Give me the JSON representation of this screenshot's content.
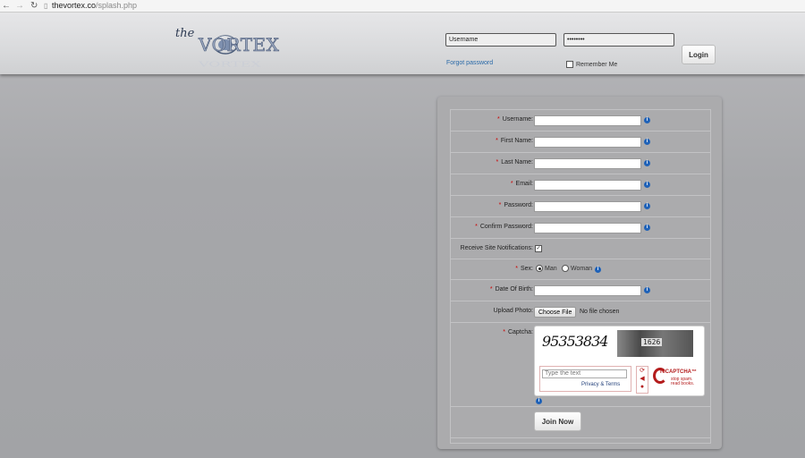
{
  "browser": {
    "back_icon": "back-arrow",
    "forward_icon": "forward-arrow",
    "reload_icon": "reload",
    "url_host": "thevortex.co",
    "url_path": "/splash.php"
  },
  "header": {
    "logo_prefix": "the",
    "logo_name": "VORTEX",
    "username_value": "Username",
    "password_value": "••••••••",
    "forgot_password": "Forgot password",
    "remember_me": "Remember Me",
    "login_label": "Login"
  },
  "form": {
    "required_mark": "*",
    "fields": {
      "username": "Username:",
      "first_name": "First Name:",
      "last_name": "Last Name:",
      "email": "Email:",
      "password": "Password:",
      "confirm_password": "Confirm Password:",
      "notifications": "Receive Site Notifications:",
      "sex": "Sex:",
      "dob": "Date Of Birth:",
      "photo": "Upload Photo:",
      "captcha": "Captcha:"
    },
    "sex_options": {
      "man": "Man",
      "woman": "Woman"
    },
    "sex_selected": "Man",
    "notifications_checked": true,
    "choose_file": "Choose File",
    "no_file": "No file chosen",
    "captcha": {
      "challenge_text": "95353834",
      "image_number": "1626",
      "input_placeholder": "Type the text",
      "privacy_terms": "Privacy & Terms",
      "brand": "reCAPTCHA™",
      "slogan_1": "stop spam.",
      "slogan_2": "read books."
    },
    "join_label": "Join Now"
  },
  "colors": {
    "accent_blue": "#1f62b8",
    "required_red": "#cc0000",
    "recaptcha_red": "#b41c1c"
  }
}
